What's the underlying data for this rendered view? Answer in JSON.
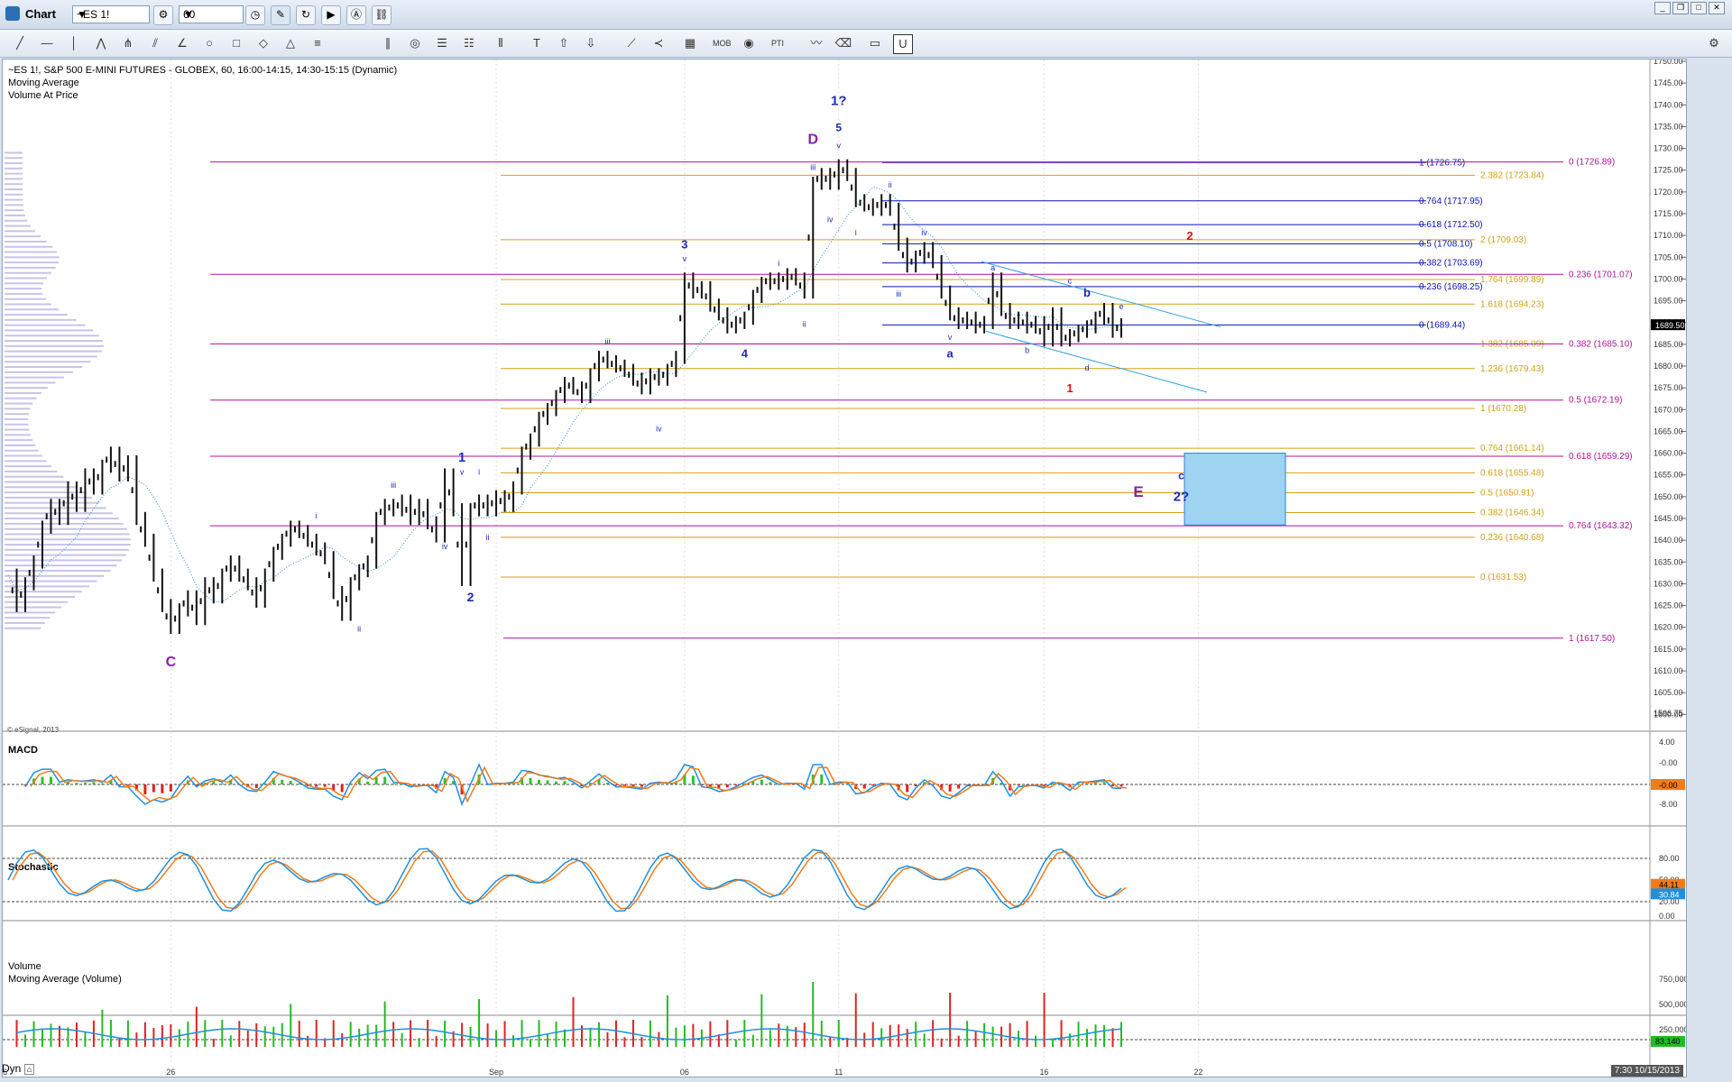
{
  "window": {
    "title": "Chart",
    "symbol": "~ES 1!",
    "interval": "60"
  },
  "header": {
    "line1": "~ES 1!, S&P 500 E-MINI FUTURES - GLOBEX, 60, 16:00-14:15, 14:30-15:15 (Dynamic)",
    "line2": "Moving Average",
    "line3": "Volume At Price",
    "copyright": "© eSignal, 2013"
  },
  "panes": {
    "macd": "MACD",
    "stochastic": "Stochastic",
    "volume": "Volume",
    "volume_ma": "Moving Average (Volume)"
  },
  "footer": {
    "dyn": "Dyn",
    "time": "7:30 10/15/2013"
  },
  "colors": {
    "blue": "#0a14b4",
    "purple": "#8b1fa8",
    "gold": "#d4a017",
    "magenta": "#b0129b",
    "red": "#e01010",
    "navy": "#1f2ab8"
  },
  "chart_data": {
    "type": "candlestick",
    "price_axis": {
      "ylim": [
        1596.75,
        1750
      ],
      "ticks": [
        1750,
        1745,
        1740,
        1735,
        1730,
        1725,
        1720,
        1715,
        1710,
        1705,
        1700,
        1695,
        1690,
        1685,
        1680,
        1675,
        1670,
        1665,
        1660,
        1655,
        1650,
        1645,
        1640,
        1635,
        1630,
        1625,
        1620,
        1615,
        1610,
        1605,
        1600
      ],
      "bottom_label": "1596.75",
      "last_price": "1689.50"
    },
    "x_ticks": [
      "26",
      "Sep",
      "06",
      "11",
      "16",
      "22",
      "26"
    ],
    "price_path": [
      [
        0,
        1632
      ],
      [
        1,
        1625
      ],
      [
        2,
        1630
      ],
      [
        3,
        1635
      ],
      [
        4,
        1643
      ],
      [
        5,
        1648
      ],
      [
        6,
        1645
      ],
      [
        7,
        1652
      ],
      [
        8,
        1648
      ],
      [
        9,
        1655
      ],
      [
        10,
        1652
      ],
      [
        11,
        1657
      ],
      [
        12,
        1660
      ],
      [
        13,
        1655
      ],
      [
        14,
        1658
      ],
      [
        15,
        1645
      ],
      [
        16,
        1640
      ],
      [
        17,
        1632
      ],
      [
        18,
        1625
      ],
      [
        19,
        1620
      ],
      [
        20,
        1624
      ],
      [
        21,
        1627
      ],
      [
        22,
        1622
      ],
      [
        23,
        1630
      ],
      [
        24,
        1627
      ],
      [
        25,
        1632
      ],
      [
        26,
        1635
      ],
      [
        27,
        1632
      ],
      [
        28,
        1630
      ],
      [
        29,
        1626
      ],
      [
        30,
        1632
      ],
      [
        31,
        1637
      ],
      [
        32,
        1640
      ],
      [
        33,
        1643
      ],
      [
        34,
        1642
      ],
      [
        35,
        1640
      ],
      [
        36,
        1638
      ],
      [
        37,
        1636
      ],
      [
        38,
        1628
      ],
      [
        39,
        1623
      ],
      [
        40,
        1630
      ],
      [
        41,
        1633
      ],
      [
        42,
        1635
      ],
      [
        43,
        1645
      ],
      [
        44,
        1648
      ],
      [
        45,
        1647
      ],
      [
        46,
        1649
      ],
      [
        47,
        1645
      ],
      [
        48,
        1648
      ],
      [
        49,
        1644
      ],
      [
        50,
        1641
      ],
      [
        51,
        1655
      ],
      [
        52,
        1647
      ],
      [
        53,
        1631
      ],
      [
        54,
        1647
      ],
      [
        55,
        1649
      ],
      [
        56,
        1647
      ],
      [
        57,
        1650
      ],
      [
        58,
        1648
      ],
      [
        59,
        1652
      ],
      [
        60,
        1660
      ],
      [
        61,
        1663
      ],
      [
        62,
        1668
      ],
      [
        63,
        1670
      ],
      [
        64,
        1673
      ],
      [
        65,
        1676
      ],
      [
        66,
        1675
      ],
      [
        67,
        1673
      ],
      [
        68,
        1678
      ],
      [
        69,
        1682
      ],
      [
        70,
        1681
      ],
      [
        71,
        1680
      ],
      [
        72,
        1679
      ],
      [
        73,
        1677
      ],
      [
        74,
        1675
      ],
      [
        75,
        1678
      ],
      [
        76,
        1677
      ],
      [
        77,
        1679
      ],
      [
        78,
        1682
      ],
      [
        79,
        1700
      ],
      [
        80,
        1697
      ],
      [
        81,
        1698
      ],
      [
        82,
        1694
      ],
      [
        83,
        1692
      ],
      [
        84,
        1689
      ],
      [
        85,
        1690
      ],
      [
        86,
        1691
      ],
      [
        87,
        1696
      ],
      [
        88,
        1699
      ],
      [
        89,
        1700
      ],
      [
        90,
        1699
      ],
      [
        91,
        1701
      ],
      [
        92,
        1700
      ],
      [
        93,
        1697
      ],
      [
        94,
        1722
      ],
      [
        95,
        1724
      ],
      [
        96,
        1722
      ],
      [
        97,
        1726
      ],
      [
        98,
        1724
      ],
      [
        99,
        1718
      ],
      [
        100,
        1717
      ],
      [
        101,
        1716
      ],
      [
        102,
        1718
      ],
      [
        103,
        1716
      ],
      [
        104,
        1708
      ],
      [
        105,
        1703
      ],
      [
        106,
        1705
      ],
      [
        107,
        1707
      ],
      [
        108,
        1704
      ],
      [
        109,
        1697
      ],
      [
        110,
        1692
      ],
      [
        111,
        1690
      ],
      [
        112,
        1691
      ],
      [
        113,
        1689
      ],
      [
        114,
        1690
      ],
      [
        115,
        1700
      ],
      [
        116,
        1693
      ],
      [
        117,
        1690
      ],
      [
        118,
        1691
      ],
      [
        119,
        1689
      ],
      [
        120,
        1690
      ],
      [
        121,
        1686
      ],
      [
        122,
        1692
      ],
      [
        123,
        1686
      ],
      [
        124,
        1687
      ],
      [
        125,
        1688
      ],
      [
        126,
        1689
      ],
      [
        127,
        1691
      ],
      [
        128,
        1693
      ],
      [
        129,
        1688
      ],
      [
        130,
        1689.5
      ]
    ],
    "fib_levels": [
      {
        "label": "1 (1726.75)",
        "price": 1726.75,
        "color": "blue"
      },
      {
        "label": "0.764 (1717.95)",
        "price": 1717.95,
        "color": "blue"
      },
      {
        "label": "0.618 (1712.50)",
        "price": 1712.5,
        "color": "blue"
      },
      {
        "label": "0.5 (1708.10)",
        "price": 1708.1,
        "color": "blue"
      },
      {
        "label": "0.382 (1703.69)",
        "price": 1703.69,
        "color": "blue"
      },
      {
        "label": "0.236 (1698.25)",
        "price": 1698.25,
        "color": "blue"
      },
      {
        "label": "0 (1689.44)",
        "price": 1689.44,
        "color": "blue"
      },
      {
        "label": "2.382 (1723.84)",
        "price": 1723.84,
        "color": "gold"
      },
      {
        "label": "2 (1709.03)",
        "price": 1709.03,
        "color": "gold"
      },
      {
        "label": "1.764 (1699.89)",
        "price": 1699.89,
        "color": "gold"
      },
      {
        "label": "1.618 (1694.23)",
        "price": 1694.23,
        "color": "gold"
      },
      {
        "label": "1.382 (1685.09)",
        "price": 1685.09,
        "color": "gold"
      },
      {
        "label": "1.236 (1679.43)",
        "price": 1679.43,
        "color": "gold"
      },
      {
        "label": "1 (1670.28)",
        "price": 1670.28,
        "color": "gold"
      },
      {
        "label": "0.764 (1661.14)",
        "price": 1661.14,
        "color": "gold"
      },
      {
        "label": "0.618 (1655.48)",
        "price": 1655.48,
        "color": "gold"
      },
      {
        "label": "0.5 (1650.91)",
        "price": 1650.91,
        "color": "gold"
      },
      {
        "label": "0.382 (1646.34)",
        "price": 1646.34,
        "color": "gold"
      },
      {
        "label": "0.236 (1640.68)",
        "price": 1640.68,
        "color": "gold"
      },
      {
        "label": "0 (1631.53)",
        "price": 1631.53,
        "color": "gold"
      },
      {
        "label": "0 (1726.89)",
        "price": 1726.89,
        "color": "magenta"
      },
      {
        "label": "0.236 (1701.07)",
        "price": 1701.07,
        "color": "magenta"
      },
      {
        "label": "0.382 (1685.10)",
        "price": 1685.1,
        "color": "magenta"
      },
      {
        "label": "0.5 (1672.19)",
        "price": 1672.19,
        "color": "magenta"
      },
      {
        "label": "0.618 (1659.29)",
        "price": 1659.29,
        "color": "magenta"
      },
      {
        "label": "0.764 (1643.32)",
        "price": 1643.32,
        "color": "magenta"
      },
      {
        "label": "1 (1617.50)",
        "price": 1617.5,
        "color": "magenta"
      }
    ],
    "wave_labels": [
      {
        "t": "C",
        "i": 19,
        "p": 1611,
        "c": "purple",
        "s": 16
      },
      {
        "t": "1",
        "i": 53,
        "p": 1658,
        "c": "navy",
        "s": 15
      },
      {
        "t": "2",
        "i": 54,
        "p": 1626,
        "c": "navy",
        "s": 14
      },
      {
        "t": "3",
        "i": 79,
        "p": 1707,
        "c": "navy",
        "s": 13
      },
      {
        "t": "4",
        "i": 86,
        "p": 1682,
        "c": "navy",
        "s": 13
      },
      {
        "t": "D",
        "i": 94,
        "p": 1731,
        "c": "purple",
        "s": 16
      },
      {
        "t": "1?",
        "i": 97,
        "p": 1740,
        "c": "navy",
        "s": 15
      },
      {
        "t": "5",
        "i": 97,
        "p": 1734,
        "c": "navy",
        "s": 12
      },
      {
        "t": "a",
        "i": 110,
        "p": 1682,
        "c": "navy",
        "s": 13
      },
      {
        "t": "b",
        "i": 126,
        "p": 1696,
        "c": "navy",
        "s": 13
      },
      {
        "t": "2",
        "i": 138,
        "p": 1709,
        "c": "red",
        "s": 13
      },
      {
        "t": "1",
        "i": 124,
        "p": 1674,
        "c": "red",
        "s": 13
      },
      {
        "t": "E",
        "i": 132,
        "p": 1650,
        "c": "purple",
        "s": 17
      },
      {
        "t": "c",
        "i": 137,
        "p": 1654,
        "c": "navy",
        "s": 12
      },
      {
        "t": "2?",
        "i": 137,
        "p": 1649,
        "c": "navy",
        "s": 15
      }
    ],
    "sub_labels": [
      {
        "t": "i",
        "i": 36,
        "p": 1645
      },
      {
        "t": "ii",
        "i": 41,
        "p": 1619
      },
      {
        "t": "iii",
        "i": 45,
        "p": 1652
      },
      {
        "t": "iv",
        "i": 51,
        "p": 1638
      },
      {
        "t": "v",
        "i": 53,
        "p": 1655
      },
      {
        "t": "i",
        "i": 55,
        "p": 1655
      },
      {
        "t": "ii",
        "i": 56,
        "p": 1640
      },
      {
        "t": "iii",
        "i": 70,
        "p": 1685
      },
      {
        "t": "iv",
        "i": 76,
        "p": 1665
      },
      {
        "t": "v",
        "i": 79,
        "p": 1704
      },
      {
        "t": "i",
        "i": 90,
        "p": 1703
      },
      {
        "t": "ii",
        "i": 93,
        "p": 1689
      },
      {
        "t": "iii",
        "i": 94,
        "p": 1725
      },
      {
        "t": "iv",
        "i": 96,
        "p": 1713
      },
      {
        "t": "v",
        "i": 97,
        "p": 1730
      },
      {
        "t": "i",
        "i": 99,
        "p": 1710
      },
      {
        "t": "ii",
        "i": 103,
        "p": 1721
      },
      {
        "t": "iii",
        "i": 104,
        "p": 1696
      },
      {
        "t": "iv",
        "i": 107,
        "p": 1710
      },
      {
        "t": "v",
        "i": 110,
        "p": 1686
      },
      {
        "t": "a",
        "i": 115,
        "p": 1702
      },
      {
        "t": "b",
        "i": 119,
        "p": 1683
      },
      {
        "t": "c",
        "i": 124,
        "p": 1699
      },
      {
        "t": "d",
        "i": 126,
        "p": 1679
      },
      {
        "t": "e",
        "i": 130,
        "p": 1693
      }
    ],
    "macd": {
      "ticks": [
        "4.00",
        "-0.00",
        "-4.00",
        "-8.00"
      ],
      "value": "-0.00"
    },
    "stochastic": {
      "ticks": [
        "80.00",
        "50.00",
        "20.00",
        "0.00"
      ],
      "k": "44.11",
      "d": "30.84"
    },
    "volume": {
      "ticks": [
        "750,000",
        "500,000",
        "250,000"
      ],
      "value": "83,140"
    }
  }
}
